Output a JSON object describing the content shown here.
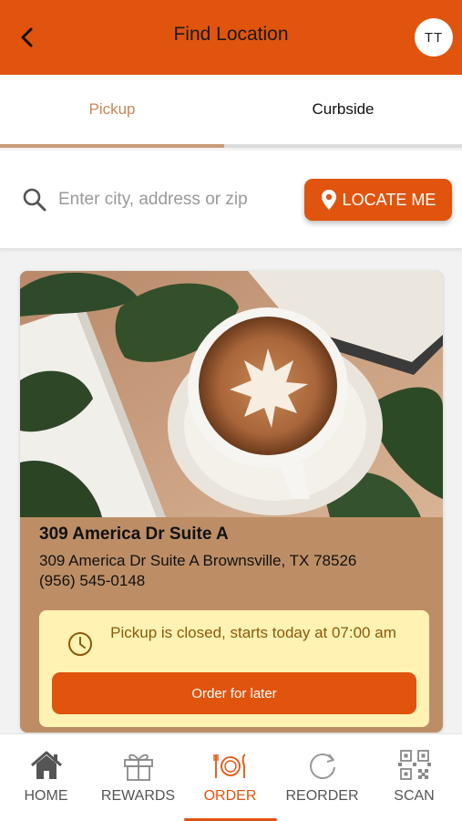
{
  "header": {
    "title": "Find Location",
    "avatar_initials": "TT",
    "back_icon": "chevron-left-icon",
    "background_color": "#e0540e"
  },
  "tabs": [
    {
      "label": "Pickup",
      "active": true
    },
    {
      "label": "Curbside",
      "active": false
    }
  ],
  "search": {
    "placeholder": "Enter city, address or zip",
    "value": "",
    "icon": "search-icon",
    "locate_label": "LOCATE ME",
    "locate_icon": "map-pin-icon"
  },
  "location": {
    "name": "309 America Dr Suite A",
    "address": "309 America Dr Suite A Brownsville, TX 78526",
    "phone": "(956) 545-0148",
    "image": "latte-art-coffee-cup-image",
    "notice": "Pickup is closed, starts today at 07:00 am",
    "notice_icon": "clock-icon",
    "order_later_label": "Order for later"
  },
  "bottom_nav": [
    {
      "label": "HOME",
      "icon": "home-icon",
      "active": false
    },
    {
      "label": "REWARDS",
      "icon": "gift-icon",
      "active": false
    },
    {
      "label": "ORDER",
      "icon": "plate-cutlery-icon",
      "active": true
    },
    {
      "label": "REORDER",
      "icon": "refresh-icon",
      "active": false
    },
    {
      "label": "SCAN",
      "icon": "qr-code-icon",
      "active": false
    }
  ],
  "colors": {
    "accent": "#e0540e",
    "card_background": "#bd8e66",
    "notice_background": "#fff2b3",
    "active_tab_text": "#c4875a"
  }
}
